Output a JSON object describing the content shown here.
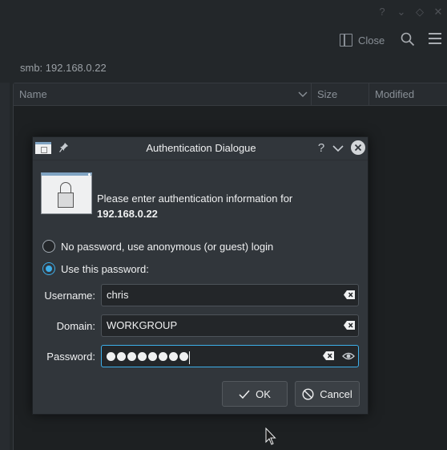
{
  "app": {
    "titlebar_buttons": [
      "?",
      "⌄",
      "◇",
      "✕"
    ],
    "close_label": "Close",
    "location": "smb: 192.168.0.22",
    "columns": [
      "Name",
      "Size",
      "Modified"
    ]
  },
  "dialog": {
    "title": "Authentication Dialogue",
    "help": "?",
    "message": "Please enter authentication information for",
    "host": "192.168.0.22",
    "radio_anonymous": "No password, use anonymous (or guest) login",
    "radio_password": "Use this password:",
    "username_label": "Username:",
    "username_value": "chris",
    "domain_label": "Domain:",
    "domain_value": "WORKGROUP",
    "password_label": "Password:",
    "password_length": 8,
    "ok_label": "OK",
    "cancel_label": "Cancel"
  },
  "colors": {
    "accent": "#3daee9",
    "background": "#31363b"
  },
  "icons": [
    "window-close-icon",
    "search-icon",
    "hamburger-menu-icon",
    "lock-icon",
    "pin-icon",
    "clear-text-icon",
    "show-password-icon",
    "checkmark-icon",
    "cancel-icon"
  ]
}
